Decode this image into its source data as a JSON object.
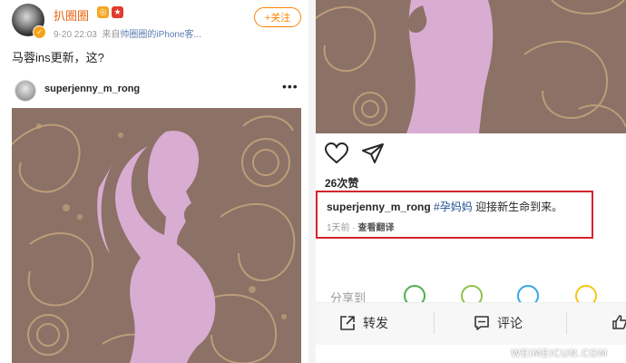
{
  "left_post": {
    "username": "扒圈圈",
    "timestamp": "9-20 22:03",
    "source_prefix": "来自",
    "source": "帅圈圈的iPhone客...",
    "follow_label": "+关注",
    "text": "马蓉ins更新，这?",
    "instagram": {
      "username": "superjenny_m_rong",
      "more_label": "•••"
    }
  },
  "right_post": {
    "likes": "26次赞",
    "caption_user": "superjenny_m_rong",
    "caption_tag": "#孕妈妈",
    "caption_text": "迎接新生命到来。",
    "time_ago": "1天前",
    "dot": "·",
    "translate_label": "查看翻译",
    "share_label": "分享到",
    "actions": {
      "repost_label": "转发",
      "comment_label": "评论"
    },
    "highlight_color": "#d4232b"
  },
  "watermark": "WEIMEICUN.COM",
  "colors": {
    "weibo_orange": "#ff8200",
    "image_brown": "#8c7167",
    "silhouette_pink": "#d9acd1",
    "paisley_gold": "#c2a27b"
  }
}
